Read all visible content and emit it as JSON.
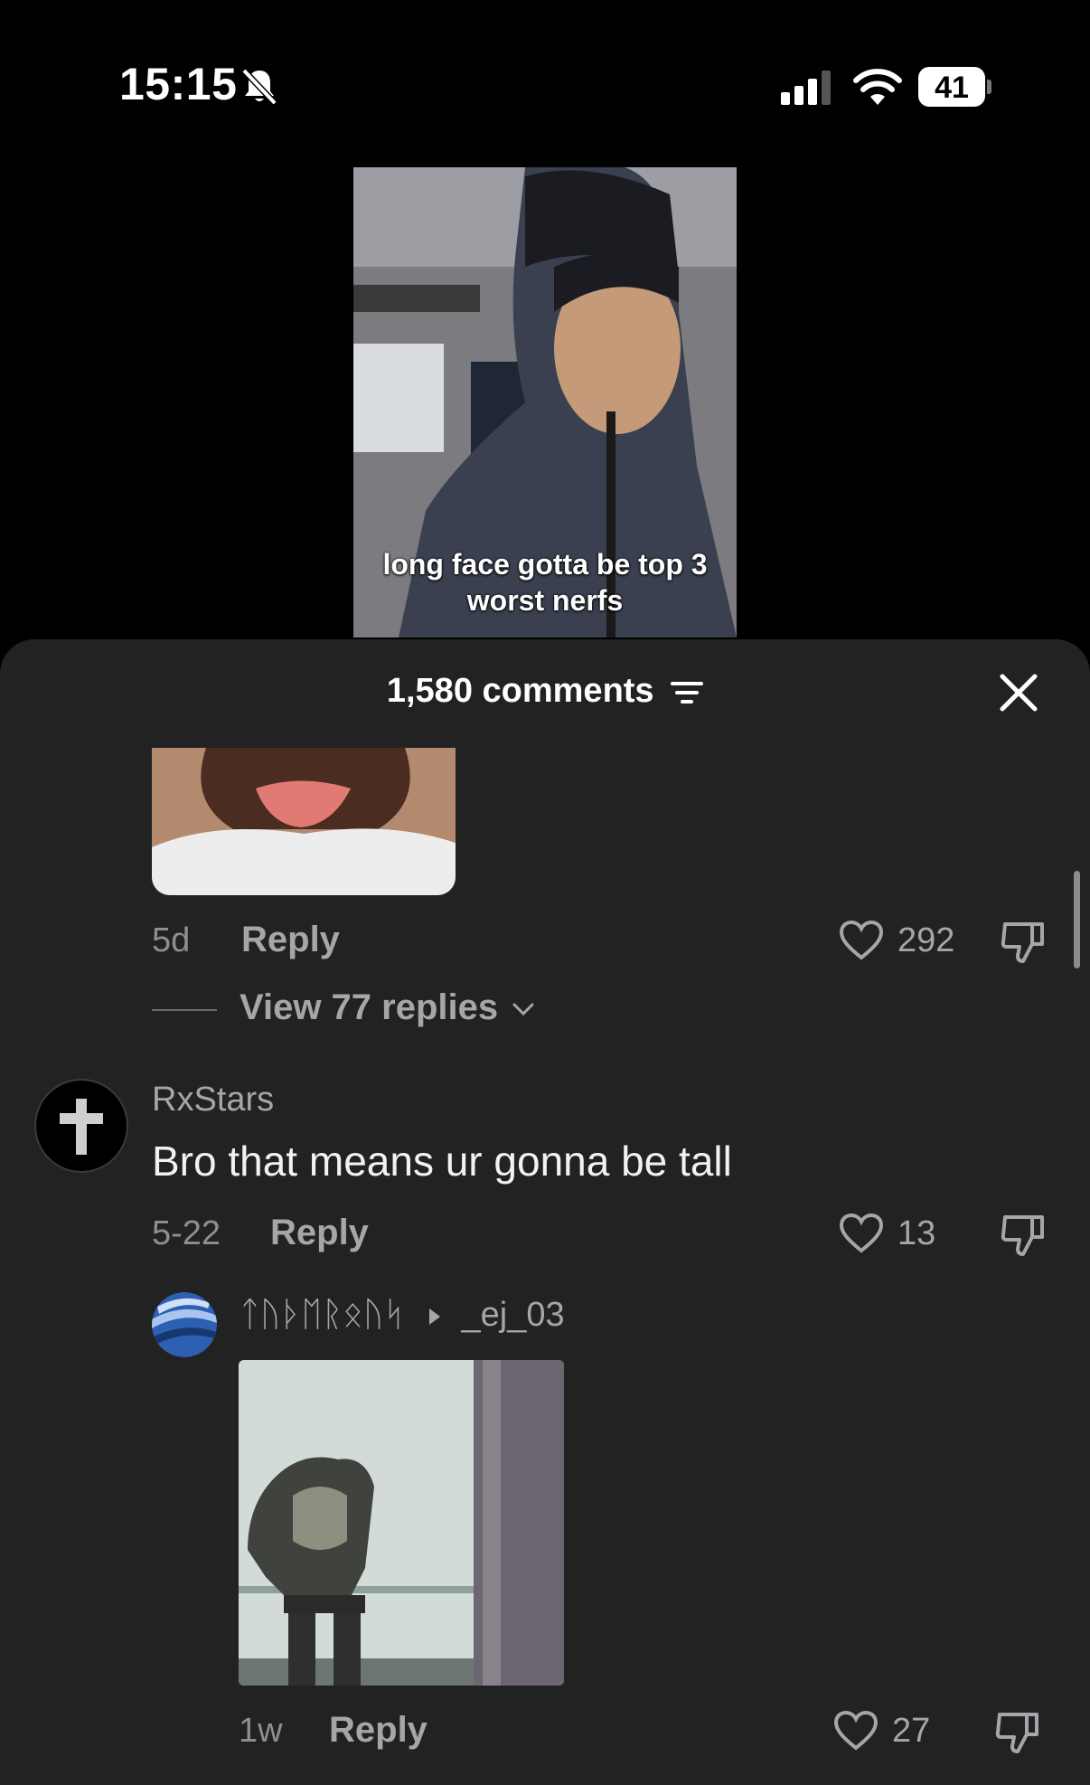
{
  "status_bar": {
    "time": "15:15",
    "battery": "41"
  },
  "video": {
    "caption_line1": "long face gotta be top 3",
    "caption_line2": "worst nerfs"
  },
  "comments_sheet": {
    "title": "1,580 comments",
    "comments": [
      {
        "time": "5d",
        "reply_label": "Reply",
        "likes": "292",
        "view_replies": "View 77 replies"
      },
      {
        "username": "RxStars",
        "text": "Bro that means ur gonna be tall",
        "time": "5-22",
        "reply_label": "Reply",
        "likes": "13"
      },
      {
        "username": "ᛏᚢᚦᛖᚱᛟᚢᛋ",
        "reply_to": "_ej_03",
        "time": "1w",
        "reply_label": "Reply",
        "likes": "27"
      }
    ]
  },
  "colors": {
    "sheet_bg": "#222223",
    "text_secondary": "#a6a6aa"
  }
}
